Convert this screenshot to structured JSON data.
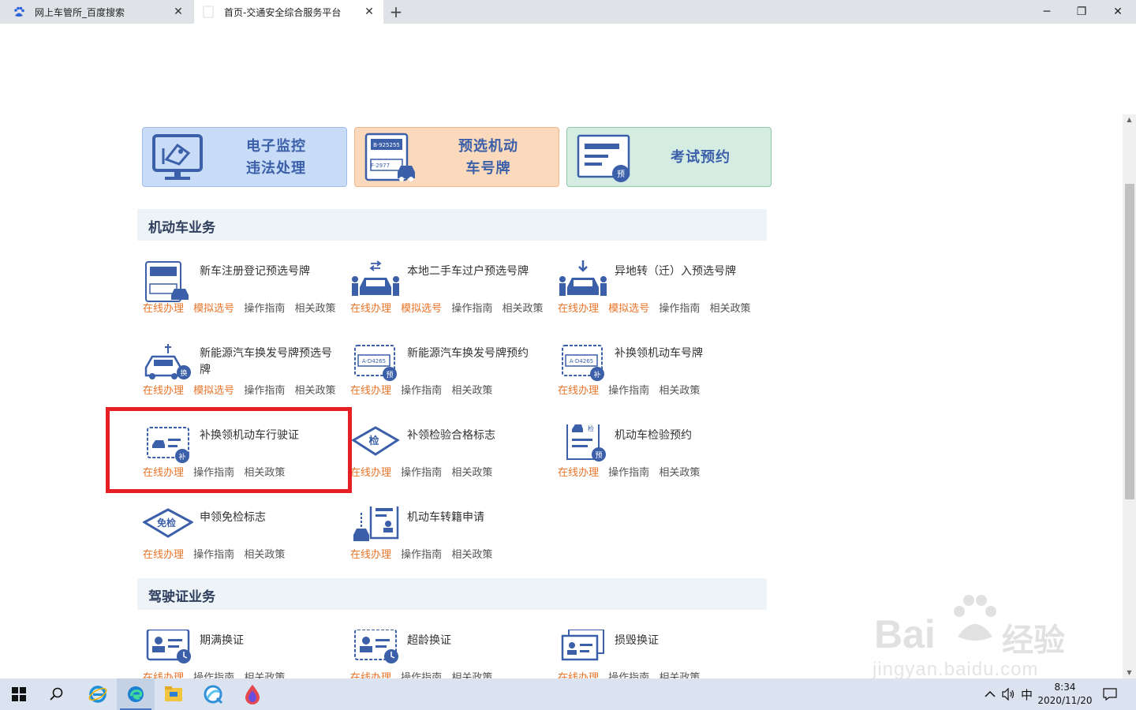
{
  "browser": {
    "tabs": [
      {
        "title": "网上车管所_百度搜索",
        "favicon": "baidu-paw-icon"
      },
      {
        "title": "首页-交通安全综合服务平台",
        "favicon": "blank-page-icon"
      }
    ],
    "new_tab": "+",
    "controls": {
      "minimize": "─",
      "restore": "❐",
      "close": "✕"
    }
  },
  "banners": [
    {
      "line1": "电子监控",
      "line2": "违法处理",
      "icon": "monitor-camera-icon",
      "color": "#c9dcf7"
    },
    {
      "line1": "预选机动",
      "line2": "车号牌",
      "icon": "license-plate-icon",
      "color": "#fbd9bd"
    },
    {
      "line1": "考试预约",
      "line2": "",
      "icon": "exam-booking-icon",
      "color": "#d5ece2"
    }
  ],
  "sections": {
    "motor": "机动车业务",
    "license": "驾驶证业务"
  },
  "links": {
    "online": "在线办理",
    "simulate": "模拟选号",
    "guide": "操作指南",
    "policy": "相关政策"
  },
  "items": [
    {
      "title": "新车注册登记预选号牌",
      "icon": "new-plate-icon"
    },
    {
      "title": "本地二手车过户预选号牌",
      "icon": "transfer-car-icon"
    },
    {
      "title": "异地转（迁）入预选号牌",
      "icon": "relocate-car-icon"
    },
    {
      "title": "新能源汽车换发号牌预选号牌",
      "icon": "ev-swap-icon",
      "badge": "换"
    },
    {
      "title": "新能源汽车换发号牌预约",
      "icon": "ev-plate-booking-icon",
      "badge": "预"
    },
    {
      "title": "补换领机动车号牌",
      "icon": "plate-reissue-icon",
      "badge": "补"
    },
    {
      "title": "补换领机动车行驶证",
      "icon": "vehicle-license-reissue-icon",
      "badge": "补"
    },
    {
      "title": "补领检验合格标志",
      "icon": "inspection-mark-icon",
      "badge": "检"
    },
    {
      "title": "机动车检验预约",
      "icon": "inspection-booking-icon",
      "badge": "检"
    },
    {
      "title": "申领免检标志",
      "icon": "exemption-mark-icon",
      "badge": "免检"
    },
    {
      "title": "机动车转籍申请",
      "icon": "car-transfer-registry-icon"
    },
    {
      "title": "期满换证",
      "icon": "expired-license-icon"
    },
    {
      "title": "超龄换证",
      "icon": "overage-license-icon"
    },
    {
      "title": "损毁换证",
      "icon": "damaged-license-icon"
    }
  ],
  "watermark": {
    "brand": "Bai",
    "brand2": "经验",
    "url": "jingyan.baidu.com"
  },
  "taskbar": {
    "ime": "中",
    "time": "8:34",
    "date": "2020/11/20"
  },
  "colors": {
    "accent_orange": "#e8742a",
    "icon_blue": "#3b5fa8",
    "highlight_red": "#e51f24"
  }
}
